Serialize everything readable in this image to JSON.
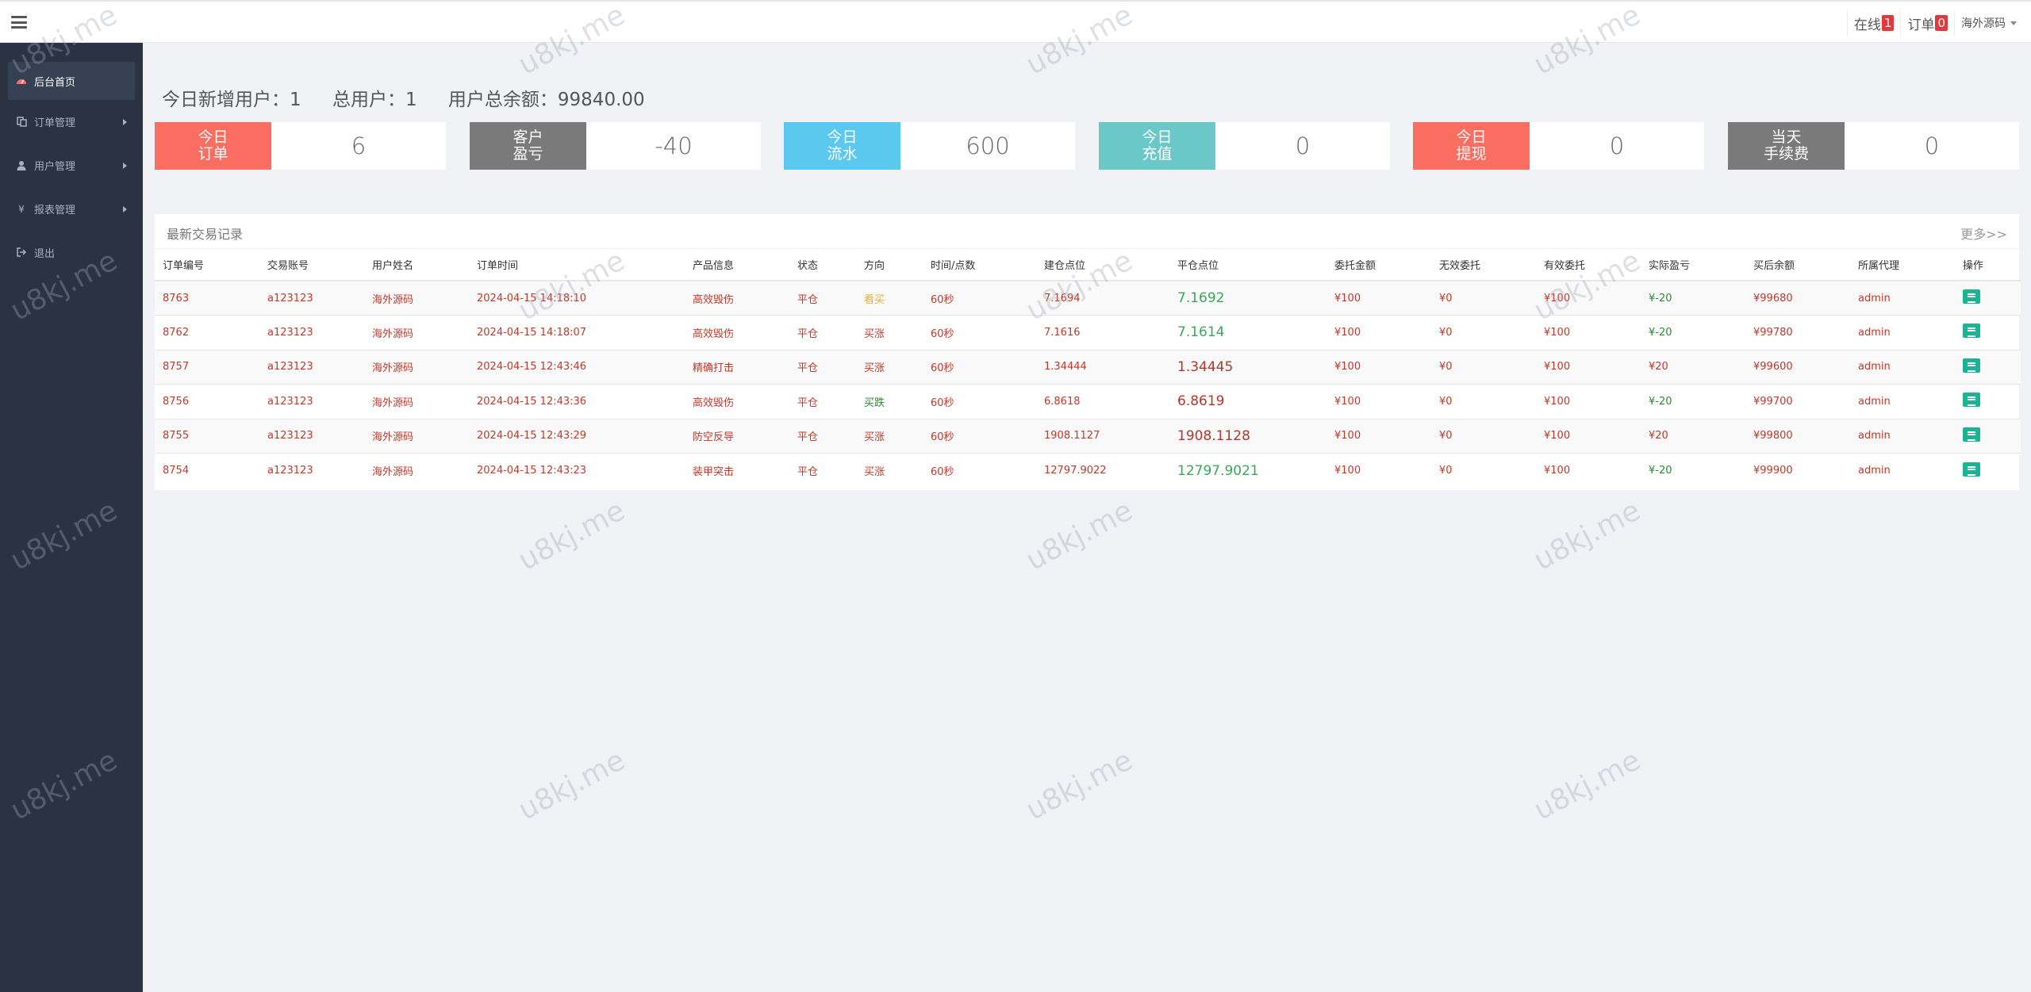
{
  "header": {
    "online_label": "在线",
    "online_count": "1",
    "orders_label": "订单",
    "orders_count": "0",
    "user_name": "海外源码"
  },
  "sidebar": {
    "items": [
      {
        "label": "后台首页",
        "icon": "dashboard-icon",
        "active": true
      },
      {
        "label": "订单管理",
        "icon": "copy-icon",
        "has_arrow": true
      },
      {
        "label": "用户管理",
        "icon": "user-icon",
        "has_arrow": true
      },
      {
        "label": "报表管理",
        "icon": "yen-icon",
        "has_arrow": true
      },
      {
        "label": "退出",
        "icon": "signout-icon",
        "has_arrow": false
      }
    ]
  },
  "summary": {
    "new_users_label": "今日新增用户：",
    "new_users": "1",
    "total_users_label": "总用户：",
    "total_users": "1",
    "balance_label": "用户总余额：",
    "balance": "99840.00"
  },
  "cards": [
    {
      "label_1": "今日",
      "label_2": "订单",
      "value": "6",
      "color": "#fa6e61"
    },
    {
      "label_1": "客户",
      "label_2": "盈亏",
      "value": "-40",
      "color": "#7a7a7a"
    },
    {
      "label_1": "今日",
      "label_2": "流水",
      "value": "600",
      "color": "#5bc8f0"
    },
    {
      "label_1": "今日",
      "label_2": "充值",
      "value": "0",
      "color": "#6bc8c8"
    },
    {
      "label_1": "今日",
      "label_2": "提现",
      "value": "0",
      "color": "#fa6e61"
    },
    {
      "label_1": "当天",
      "label_2": "手续费",
      "value": "0",
      "color": "#7a7a7a"
    }
  ],
  "panel": {
    "title": "最新交易记录",
    "more": "更多>>",
    "columns": [
      "订单编号",
      "交易账号",
      "用户姓名",
      "订单时间",
      "产品信息",
      "状态",
      "方向",
      "时间/点数",
      "建仓点位",
      "平仓点位",
      "委托金额",
      "无效委托",
      "有效委托",
      "实际盈亏",
      "买后余额",
      "所属代理",
      "操作"
    ],
    "rows": [
      [
        "8763",
        "a123123",
        "海外源码",
        "2024-04-15 14:18:10",
        "高效毁伤",
        "平仓",
        "看买",
        "60秒",
        "7.1694",
        "7.1692",
        "¥100",
        "¥0",
        "¥100",
        "¥-20",
        "¥99680",
        "admin"
      ],
      [
        "8762",
        "a123123",
        "海外源码",
        "2024-04-15 14:18:07",
        "高效毁伤",
        "平仓",
        "买涨",
        "60秒",
        "7.1616",
        "7.1614",
        "¥100",
        "¥0",
        "¥100",
        "¥-20",
        "¥99780",
        "admin"
      ],
      [
        "8757",
        "a123123",
        "海外源码",
        "2024-04-15 12:43:46",
        "精确打击",
        "平仓",
        "买涨",
        "60秒",
        "1.34444",
        "1.34445",
        "¥100",
        "¥0",
        "¥100",
        "¥20",
        "¥99600",
        "admin"
      ],
      [
        "8756",
        "a123123",
        "海外源码",
        "2024-04-15 12:43:36",
        "高效毁伤",
        "平仓",
        "买跌",
        "60秒",
        "6.8618",
        "6.8619",
        "¥100",
        "¥0",
        "¥100",
        "¥-20",
        "¥99700",
        "admin"
      ],
      [
        "8755",
        "a123123",
        "海外源码",
        "2024-04-15 12:43:29",
        "防空反导",
        "平仓",
        "买涨",
        "60秒",
        "1908.1127",
        "1908.1128",
        "¥100",
        "¥0",
        "¥100",
        "¥20",
        "¥99800",
        "admin"
      ],
      [
        "8754",
        "a123123",
        "海外源码",
        "2024-04-15 12:43:23",
        "装甲突击",
        "平仓",
        "买涨",
        "60秒",
        "12797.9022",
        "12797.9021",
        "¥100",
        "¥0",
        "¥100",
        "¥-20",
        "¥99900",
        "admin"
      ]
    ],
    "close_colors": [
      "green",
      "green",
      "red",
      "red",
      "red",
      "green"
    ],
    "direction_colors": [
      "up",
      "",
      "",
      "green",
      "",
      ""
    ]
  },
  "watermark": "u8kj.me",
  "colors": {
    "sidebar": "#2b3342",
    "action_button": "#1ab394",
    "positive": "#2c8a34",
    "negative": "#c0392b"
  }
}
